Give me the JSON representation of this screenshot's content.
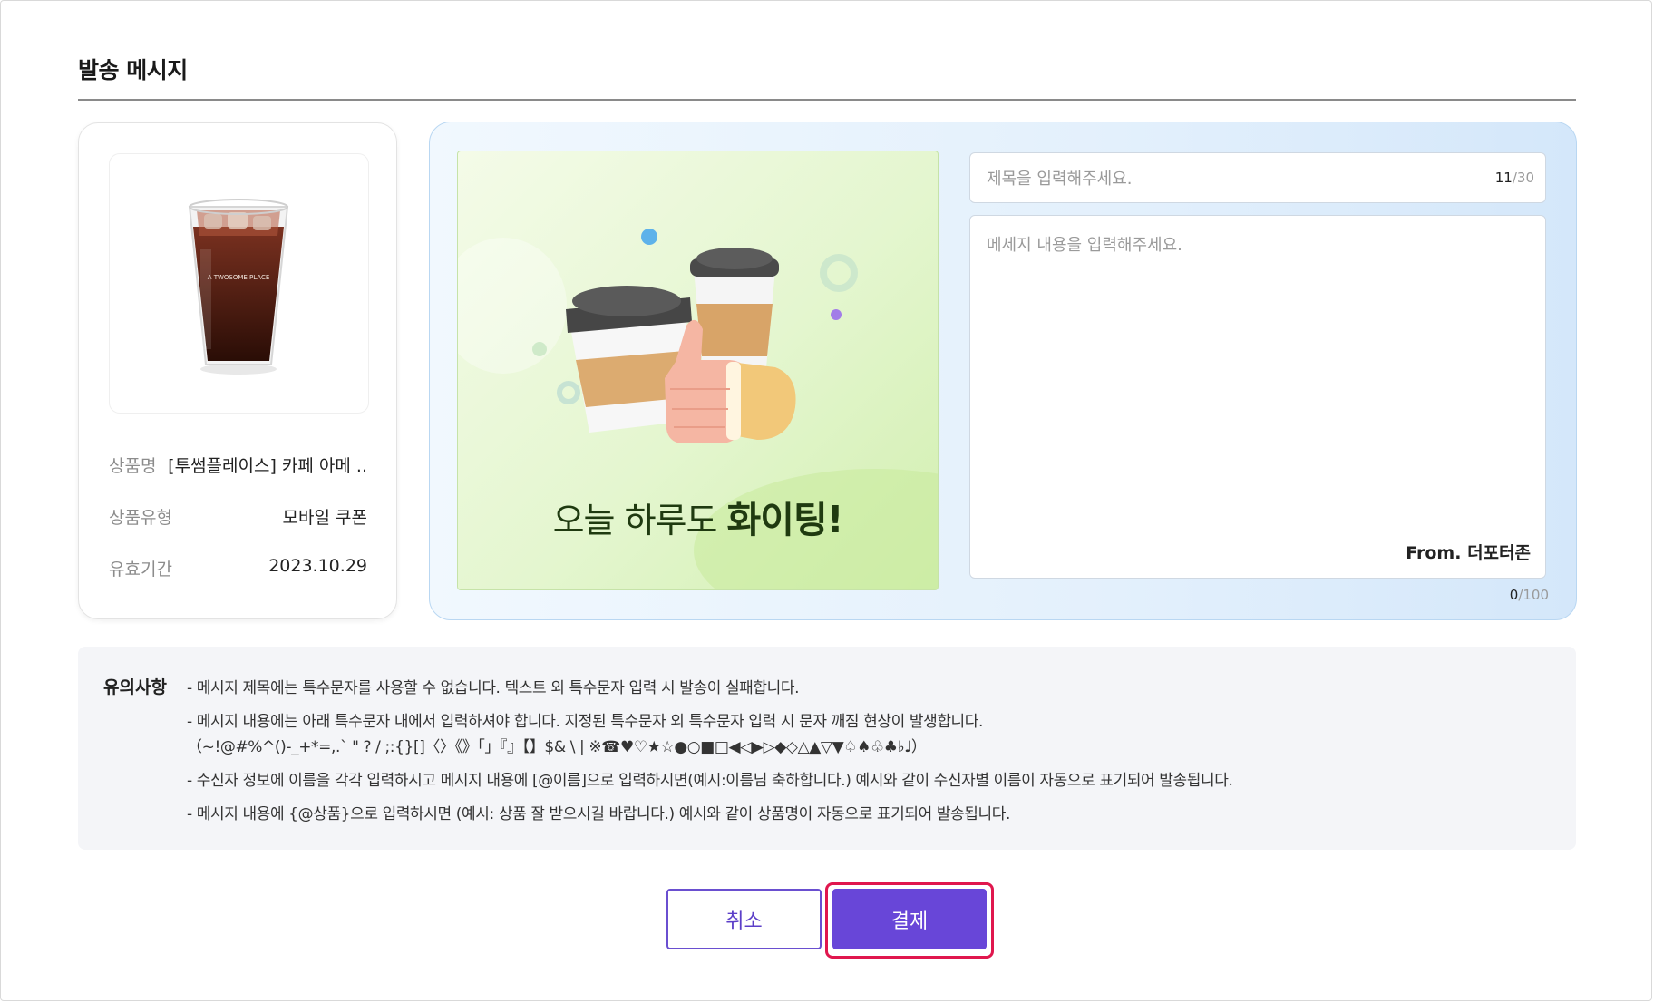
{
  "section": {
    "title": "발송 메시지"
  },
  "product": {
    "image_icon": "iced-coffee-cup-image",
    "cup_brand_text": "A TWOSOME PLACE",
    "rows": [
      {
        "label": "상품명",
        "value": "[투썸플레이스] 카페 아메 .."
      },
      {
        "label": "상품유형",
        "value": "모바일 쿠폰"
      },
      {
        "label": "유효기간",
        "value": "2023.10.29"
      }
    ]
  },
  "message": {
    "card_caption_normal": "오늘 하루도 ",
    "card_caption_bold": "화이팅!",
    "subject_placeholder": "제목을 입력해주세요.",
    "subject_value": "",
    "subject_count": "11",
    "subject_max": "/30",
    "body_placeholder": "메세지 내용을 입력해주세요.",
    "body_value": "",
    "from_label": "From. 더포터존",
    "body_count": "0",
    "body_max": "/100"
  },
  "notice": {
    "title": "유의사항",
    "lines": [
      "- 메시지 제목에는 특수문자를 사용할 수 없습니다. 텍스트 외 특수문자 입력 시 발송이 실패합니다.",
      "- 메시지 내용에는 아래 특수문자 내에서 입력하셔야 합니다. 지정된 특수문자 외 특수문자 입력 시 문자 깨짐 현상이 발생합니다.",
      "（~!@#%^()-_+*=,.` \" ? / ;:{}[]〈〉《》「」『』【】$& \\ | ※☎♥♡★☆●○■□◀◁▶▷◆◇△▲▽▼♤♠♧♣♭♩）",
      "- 수신자 정보에 이름을 각각 입력하시고 메시지 내용에 [@이름]으로 입력하시면(예시:이름님 축하합니다.) 예시와 같이 수신자별 이름이 자동으로 표기되어 발송됩니다.",
      "- 메시지 내용에 {@상품}으로 입력하시면 (예시: 상품 잘 받으시길 바랍니다.)  예시와 같이 상품명이 자동으로 표기되어 발송됩니다."
    ]
  },
  "actions": {
    "cancel_label": "취소",
    "pay_label": "결제"
  },
  "colors": {
    "accent": "#6846d8",
    "highlight": "#e0174e",
    "panel_border": "#b9d7f2"
  }
}
